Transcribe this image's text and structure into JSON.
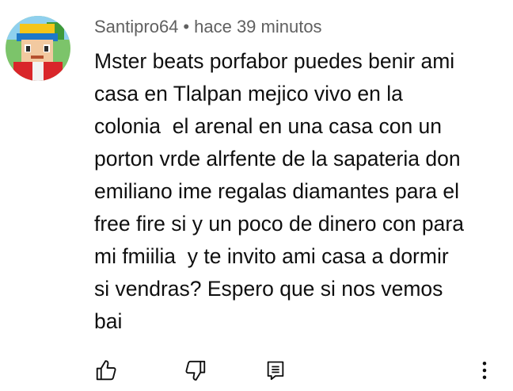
{
  "comment": {
    "author": "Santipro64",
    "separator": "•",
    "time": "hace 39 minutos",
    "lines": [
      "Mster beats porfabor puedes benir ami",
      "casa en Tlalpan mejico vivo en la",
      "colonia  el arenal en una casa con un",
      "porton vrde alrfente de la sapateria don",
      "emiliano ime regalas diamantes para el",
      "free fire si y un poco de dinero con para",
      "mi fmiilia  y te invito ami casa a dormir",
      "si vendras? Espero que si nos vemos",
      "bai"
    ]
  },
  "actions": {
    "like_icon": "thumbs-up-icon",
    "dislike_icon": "thumbs-down-icon",
    "reply_icon": "reply-icon",
    "more_icon": "more-vertical-icon"
  },
  "colors": {
    "text": "#0f0f0f",
    "meta": "#606060",
    "background": "#ffffff"
  }
}
